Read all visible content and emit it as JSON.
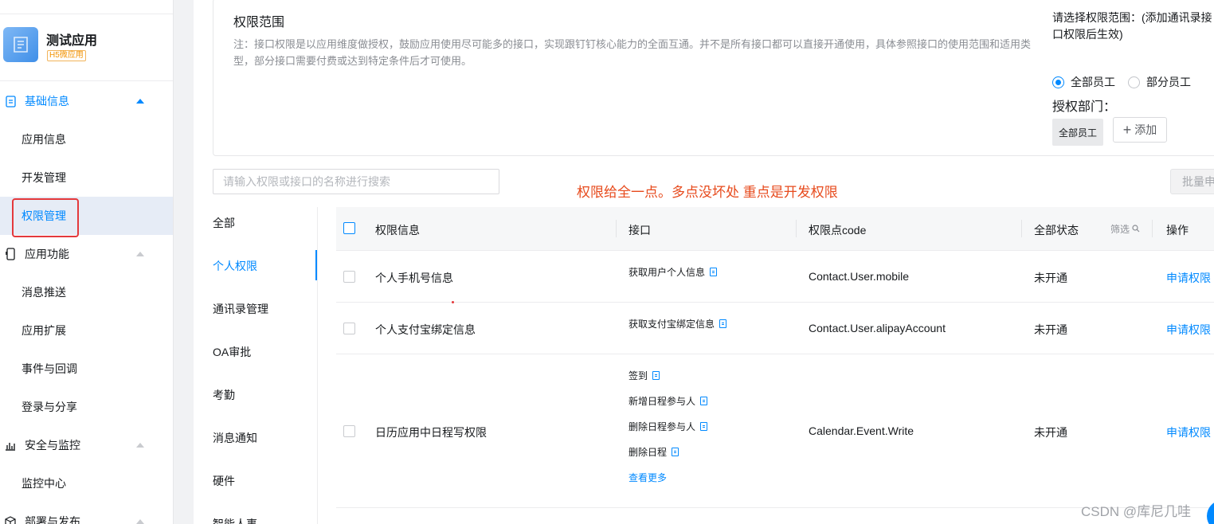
{
  "app": {
    "name": "测试应用",
    "badge": "H5微应用"
  },
  "sidebar": {
    "groups": [
      {
        "label": "基础信息",
        "items": [
          "应用信息",
          "开发管理",
          "权限管理"
        ]
      },
      {
        "label": "应用功能",
        "items": [
          "消息推送",
          "应用扩展",
          "事件与回调",
          "登录与分享"
        ]
      },
      {
        "label": "安全与监控",
        "items": [
          "监控中心"
        ]
      },
      {
        "label": "部署与发布",
        "items": []
      }
    ]
  },
  "scope": {
    "title": "权限范围",
    "note": "注：接口权限是以应用维度做授权，鼓励应用使用尽可能多的接口，实现跟钉钉核心能力的全面互通。并不是所有接口都可以直接开通使用，具体参照接口的使用范围和适用类型，部分接口需要付费或达到特定条件后才可使用。",
    "hint": "请选择权限范围：(添加通讯录接口权限后生效)",
    "options": [
      "全部员工",
      "部分员工"
    ],
    "auth_dept_label": "授权部门：",
    "dept_tag": "全部员工",
    "add_label": "添加"
  },
  "search": {
    "placeholder": "请输入权限或接口的名称进行搜索"
  },
  "annotation": "权限给全一点。多点没坏处 重点是开发权限",
  "bulk_label": "批量申",
  "categories": [
    "全部",
    "个人权限",
    "通讯录管理",
    "OA审批",
    "考勤",
    "消息通知",
    "硬件",
    "智能人事"
  ],
  "table": {
    "headers": {
      "info": "权限信息",
      "api": "接口",
      "code": "权限点code",
      "status": "全部状态",
      "filter": "筛选",
      "op": "操作"
    },
    "rows": [
      {
        "info": "个人手机号信息",
        "apis": [
          "获取用户个人信息"
        ],
        "code": "Contact.User.mobile",
        "status": "未开通",
        "op": "申请权限"
      },
      {
        "info": "个人支付宝绑定信息",
        "apis": [
          "获取支付宝绑定信息"
        ],
        "code": "Contact.User.alipayAccount",
        "status": "未开通",
        "op": "申请权限"
      },
      {
        "info": "日历应用中日程写权限",
        "apis": [
          "签到",
          "新增日程参与人",
          "删除日程参与人",
          "删除日程"
        ],
        "more": "查看更多",
        "code": "Calendar.Event.Write",
        "status": "未开通",
        "op": "申请权限"
      }
    ]
  },
  "watermark": "CSDN @库尼几哇",
  "colors": {
    "accent": "#0089ff",
    "annotation": "#e74a1c",
    "highlight_box": "#e4393c"
  }
}
